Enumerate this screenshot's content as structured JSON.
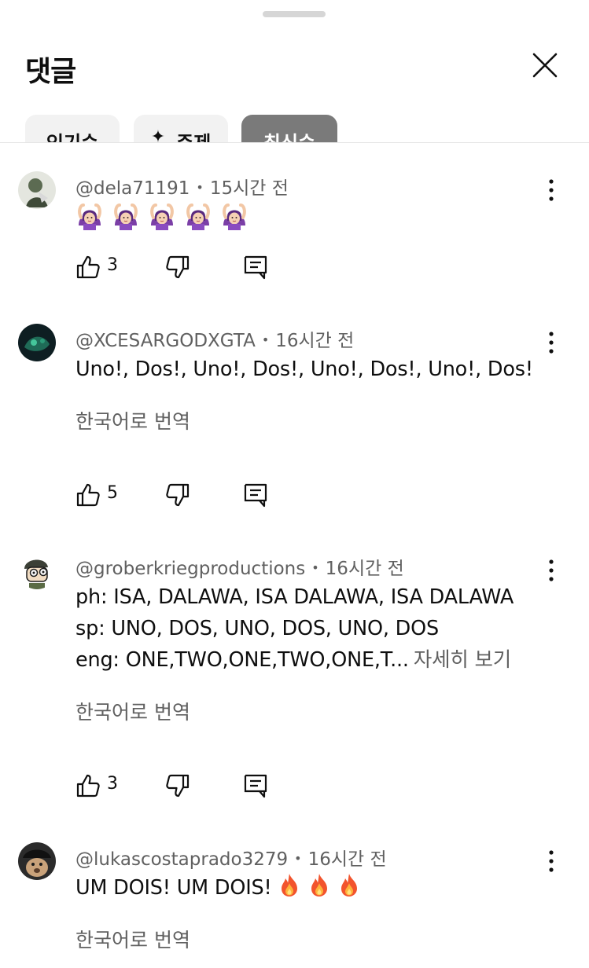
{
  "header": {
    "title": "댓글",
    "close_icon": "close-icon"
  },
  "sort_chips": [
    {
      "label": "인기순",
      "active": false
    },
    {
      "label": "주제",
      "icon": "sparkle-icon",
      "active": false
    },
    {
      "label": "최신순",
      "active": true
    }
  ],
  "comments": [
    {
      "author": "@dela71191",
      "time": "15시간 전",
      "text": "",
      "emoji": "person-gesturing-ok-emoji",
      "emoji_count": 5,
      "likes": "3"
    },
    {
      "author": "@XCESARGODXGTA",
      "time": "16시간 전",
      "text": "Uno!, Dos!, Uno!, Dos!, Uno!, Dos!, Uno!, Dos!",
      "translate": "한국어로 번역",
      "likes": "5"
    },
    {
      "author": "@groberkriegproductions",
      "time": "16시간 전",
      "lines": [
        "ph: ISA, DALAWA, ISA DALAWA, ISA DALAWA",
        "sp: UNO, DOS, UNO, DOS, UNO, DOS",
        "eng: ONE,TWO,ONE,TWO,ONE,T..."
      ],
      "read_more": "자세히 보기",
      "translate": "한국어로 번역",
      "likes": "3"
    },
    {
      "author": "@lukascostaprado3279",
      "time": "16시간 전",
      "text": "UM DOIS! UM DOIS!",
      "emoji": "fire-emoji",
      "emoji_count": 3,
      "translate": "한국어로 번역"
    }
  ],
  "colors": {
    "text": "#0f0f0f",
    "secondary": "#606060",
    "chip_bg": "#f2f2f2",
    "chip_active": "#0f0f0f"
  }
}
